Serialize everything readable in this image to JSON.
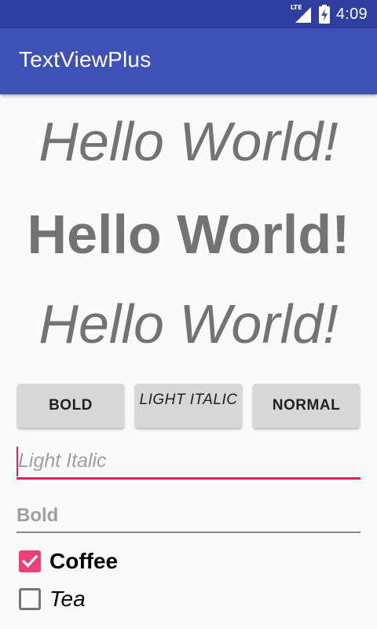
{
  "status_bar": {
    "network_type": "LTE",
    "time": "4:09",
    "icons": [
      "lte-signal-icon",
      "battery-charging-icon"
    ]
  },
  "app_bar": {
    "title": "TextViewPlus"
  },
  "main": {
    "hello_texts": [
      "Hello World!",
      "Hello World!",
      "Hello World!"
    ],
    "buttons": [
      {
        "label": "BOLD"
      },
      {
        "label": "LIGHT ITALIC"
      },
      {
        "label": "NORMAL"
      }
    ],
    "fields": [
      {
        "value": "",
        "placeholder": "Light Italic",
        "focused": true
      },
      {
        "value": "",
        "placeholder": "Bold",
        "focused": false
      }
    ],
    "checkboxes": [
      {
        "label": "Coffee",
        "checked": true
      },
      {
        "label": "Tea",
        "checked": false
      }
    ]
  },
  "colors": {
    "status_bar": "#303f9f",
    "app_bar": "#3f51b5",
    "accent": "#e91e63",
    "checkbox_checked": "#ec407a",
    "hello_text": "#737373",
    "button_bg": "#d6d7d7"
  }
}
